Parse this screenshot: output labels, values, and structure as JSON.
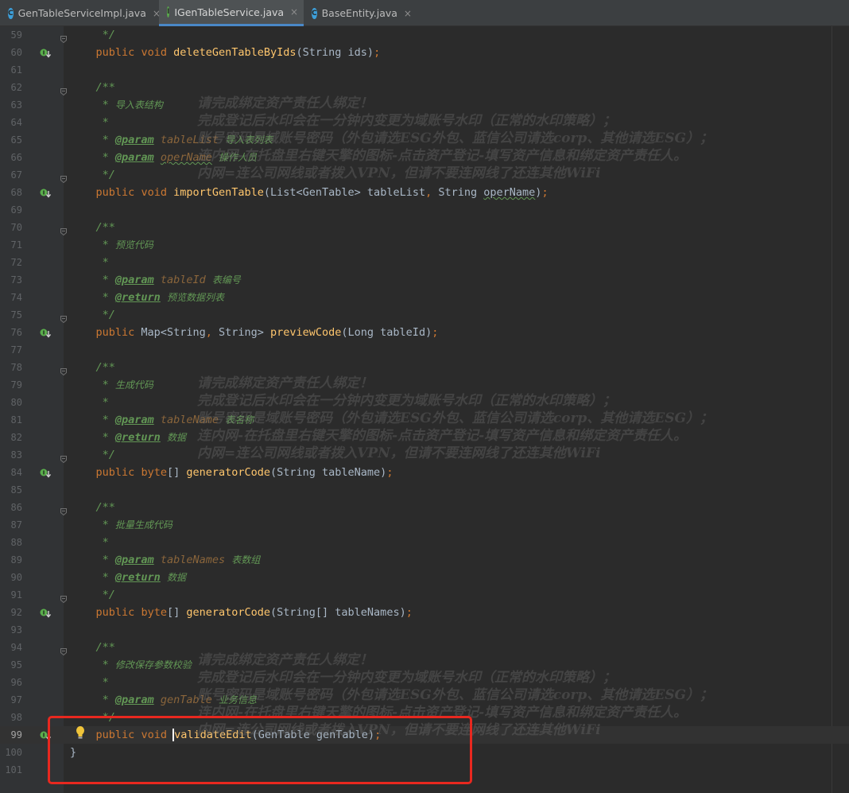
{
  "tabs": [
    {
      "label": "GenTableServiceImpl.java",
      "icon": "class-icon",
      "icon_letter": "C",
      "active": false
    },
    {
      "label": "IGenTableService.java",
      "icon": "interface-icon",
      "icon_letter": "I",
      "active": true
    },
    {
      "label": "BaseEntity.java",
      "icon": "class-icon",
      "icon_letter": "C",
      "active": false
    }
  ],
  "close_glyph": "×",
  "lines": [
    {
      "n": "59",
      "text": "     */"
    },
    {
      "n": "60",
      "text": "    public void deleteGenTableByIds(String ids);"
    },
    {
      "n": "61",
      "text": ""
    },
    {
      "n": "62",
      "text": "    /**"
    },
    {
      "n": "63",
      "text": "     * 导入表结构"
    },
    {
      "n": "64",
      "text": "     *"
    },
    {
      "n": "65",
      "text": "     * @param tableList 导入表列表"
    },
    {
      "n": "66",
      "text": "     * @param operName 操作人员"
    },
    {
      "n": "67",
      "text": "     */"
    },
    {
      "n": "68",
      "text": "    public void importGenTable(List<GenTable> tableList, String operName);"
    },
    {
      "n": "69",
      "text": ""
    },
    {
      "n": "70",
      "text": "    /**"
    },
    {
      "n": "71",
      "text": "     * 预览代码"
    },
    {
      "n": "72",
      "text": "     *"
    },
    {
      "n": "73",
      "text": "     * @param tableId 表编号"
    },
    {
      "n": "74",
      "text": "     * @return 预览数据列表"
    },
    {
      "n": "75",
      "text": "     */"
    },
    {
      "n": "76",
      "text": "    public Map<String, String> previewCode(Long tableId);"
    },
    {
      "n": "77",
      "text": ""
    },
    {
      "n": "78",
      "text": "    /**"
    },
    {
      "n": "79",
      "text": "     * 生成代码"
    },
    {
      "n": "80",
      "text": "     *"
    },
    {
      "n": "81",
      "text": "     * @param tableName 表名称"
    },
    {
      "n": "82",
      "text": "     * @return 数据"
    },
    {
      "n": "83",
      "text": "     */"
    },
    {
      "n": "84",
      "text": "    public byte[] generatorCode(String tableName);"
    },
    {
      "n": "85",
      "text": ""
    },
    {
      "n": "86",
      "text": "    /**"
    },
    {
      "n": "87",
      "text": "     * 批量生成代码"
    },
    {
      "n": "88",
      "text": "     *"
    },
    {
      "n": "89",
      "text": "     * @param tableNames 表数组"
    },
    {
      "n": "90",
      "text": "     * @return 数据"
    },
    {
      "n": "91",
      "text": "     */"
    },
    {
      "n": "92",
      "text": "    public byte[] generatorCode(String[] tableNames);"
    },
    {
      "n": "93",
      "text": ""
    },
    {
      "n": "94",
      "text": "    /**"
    },
    {
      "n": "95",
      "text": "     * 修改保存参数校验"
    },
    {
      "n": "96",
      "text": "     *"
    },
    {
      "n": "97",
      "text": "     * @param genTable 业务信息"
    },
    {
      "n": "98",
      "text": "     */"
    },
    {
      "n": "99",
      "text": "    public void validateEdit(GenTable genTable);"
    },
    {
      "n": "100",
      "text": "}"
    },
    {
      "n": "101",
      "text": ""
    }
  ],
  "current_line": "99",
  "implemented_lines": [
    "60",
    "68",
    "76",
    "84",
    "92",
    "99"
  ],
  "fold_lines": [
    "59",
    "62",
    "67",
    "70",
    "75",
    "78",
    "83",
    "86",
    "91",
    "94"
  ],
  "watermark": [
    "请完成绑定资产责任人绑定！",
    "完成登记后水印会在一分钟内变更为域账号水印（正常的水印策略）；",
    "账号密码是域账号密码（外包请选ESG外包、蓝信公司请选corp、其他请选ESG）；",
    "连内网-在托盘里右键天擎的图标-点击资产登记-填写资产信息和绑定资产责任人。",
    "内网=连公司网线或者拨入VPN，但请不要连网线了还连其他WiFi"
  ],
  "colors": {
    "background": "#2b2b2b",
    "gutter": "#313335",
    "keyword": "#cc7832",
    "method": "#ffc66d",
    "comment": "#629755",
    "highlight_box": "#e8281f"
  }
}
